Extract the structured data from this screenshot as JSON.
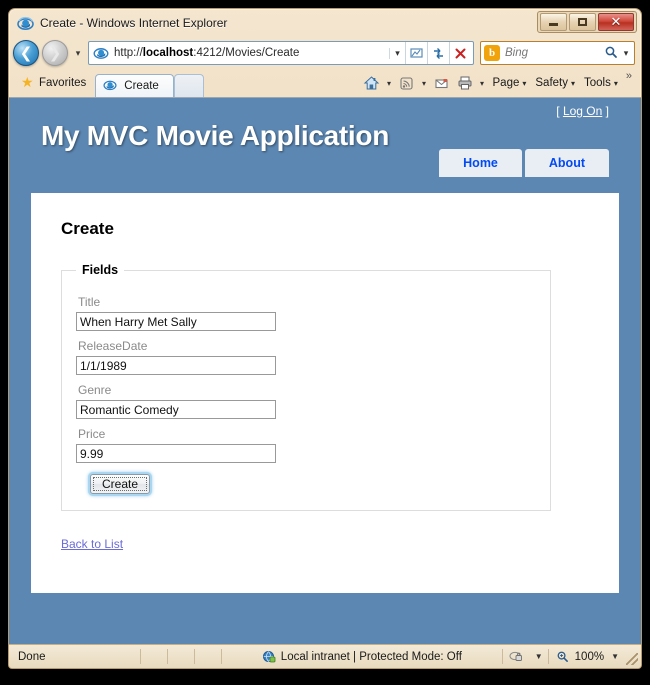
{
  "window": {
    "title": "Create - Windows Internet Explorer",
    "app_icon": "internet-explorer-icon",
    "controls": {
      "minimize": "minimize-button",
      "restore": "restore-button",
      "close_glyph": "✕"
    }
  },
  "address_bar": {
    "back_label": "◄",
    "forward_label": "►",
    "history_arrow": "▼",
    "url_prefix": "http://",
    "url_host": "localhost",
    "url_rest": ":4212/Movies/Create",
    "url_full": "http://localhost:4212/Movies/Create",
    "dropdown_arrow": "▼",
    "compat_icon": "compatibility-view-icon",
    "refresh_icon": "↻",
    "stop_icon": "✕",
    "search": {
      "provider": "Bing",
      "logo_letter": "b",
      "placeholder": "Bing",
      "search_icon": "🔍",
      "dropdown_arrow": "▼"
    }
  },
  "command_bar": {
    "favorites_label": "Favorites",
    "favorites_icon": "star-icon",
    "tabs": [
      {
        "label": "Create",
        "icon": "internet-explorer-icon",
        "active": true
      }
    ],
    "new_tab_label": "",
    "icons": [
      {
        "name": "home-icon",
        "has_dropdown": true
      },
      {
        "name": "feeds-icon",
        "has_dropdown": true
      },
      {
        "name": "mail-icon",
        "has_dropdown": false
      },
      {
        "name": "print-icon",
        "has_dropdown": true
      }
    ],
    "menus": [
      {
        "label": "Page"
      },
      {
        "label": "Safety"
      },
      {
        "label": "Tools"
      }
    ],
    "overflow_label": "»"
  },
  "site": {
    "title": "My MVC Movie Application",
    "logon_open_bracket": "[",
    "logon_label": "Log On",
    "logon_close_bracket": "]",
    "menu": [
      {
        "label": "Home"
      },
      {
        "label": "About"
      }
    ]
  },
  "main": {
    "page_title": "Create",
    "fieldset_legend": "Fields",
    "fields": [
      {
        "label": "Title",
        "value": "When Harry Met Sally",
        "name": "title"
      },
      {
        "label": "ReleaseDate",
        "value": "1/1/1989",
        "name": "releasedate"
      },
      {
        "label": "Genre",
        "value": "Romantic Comedy",
        "name": "genre"
      },
      {
        "label": "Price",
        "value": "9.99",
        "name": "price"
      }
    ],
    "submit_label": "Create",
    "back_link_label": "Back to List"
  },
  "status_bar": {
    "status": "Done",
    "zone_icon": "internet-zone-icon",
    "zone_text": "Local intranet | Protected Mode: Off",
    "security_icon": "privacy-icon",
    "security_dropdown": "▼",
    "zoom_icon": "zoom-icon",
    "zoom_level": "100%",
    "zoom_dropdown": "▼"
  },
  "colors": {
    "header_blue": "#5c87b2",
    "nav_link_blue": "#034af3",
    "link_purple": "#6b6bd6",
    "accent_orange": "#f0a30a"
  }
}
